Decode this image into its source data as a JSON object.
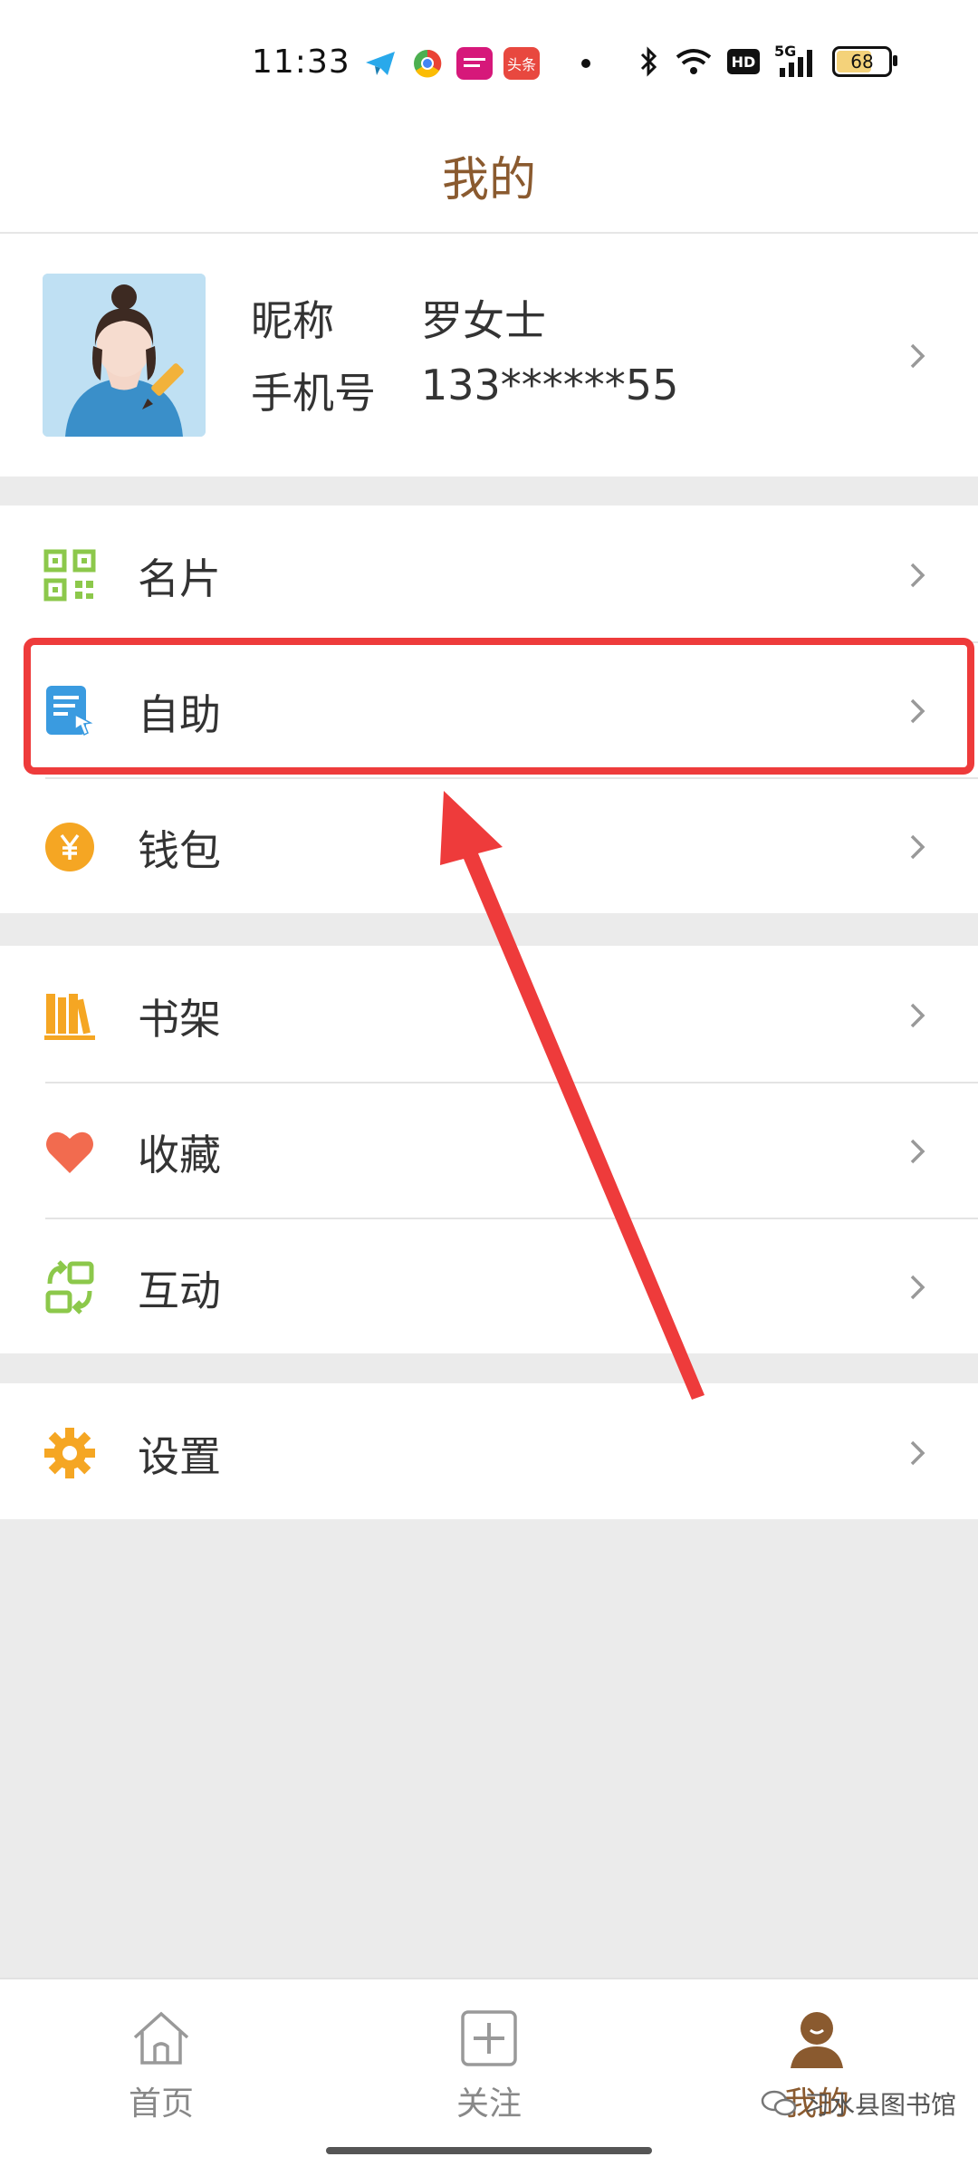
{
  "status_bar": {
    "time": "11:33",
    "app_icons": [
      "telegram-icon",
      "chrome-icon",
      "app-icon-pink",
      "toutiao-icon"
    ],
    "toutiao_label": "头条",
    "network_label": "5G",
    "hd_label": "HD",
    "battery": "68"
  },
  "header": {
    "title": "我的"
  },
  "profile": {
    "nickname_label": "昵称",
    "nickname_value": "罗女士",
    "phone_label": "手机号",
    "phone_value": "133******55"
  },
  "menu": {
    "group1": [
      {
        "label": "名片",
        "icon": "qrcode-icon",
        "color": "#8cc84b"
      },
      {
        "label": "自助",
        "icon": "self-service-icon",
        "color": "#3a9be0"
      },
      {
        "label": "钱包",
        "icon": "yuan-coin-icon",
        "color": "#f5a623"
      }
    ],
    "group2": [
      {
        "label": "书架",
        "icon": "bookshelf-icon",
        "color": "#f5a623"
      },
      {
        "label": "收藏",
        "icon": "heart-icon",
        "color": "#f26b4f"
      },
      {
        "label": "互动",
        "icon": "interact-icon",
        "color": "#8cc84b"
      }
    ],
    "group3": [
      {
        "label": "设置",
        "icon": "gear-icon",
        "color": "#f5a623"
      }
    ]
  },
  "tabbar": {
    "tabs": [
      {
        "label": "首页",
        "icon": "home-icon"
      },
      {
        "label": "关注",
        "icon": "plus-box-icon"
      },
      {
        "label": "我的",
        "icon": "user-icon",
        "active": true
      }
    ]
  },
  "watermark": "习水县图书馆",
  "colors": {
    "accent": "#8a5a2f",
    "highlight": "#ee3b3b"
  }
}
